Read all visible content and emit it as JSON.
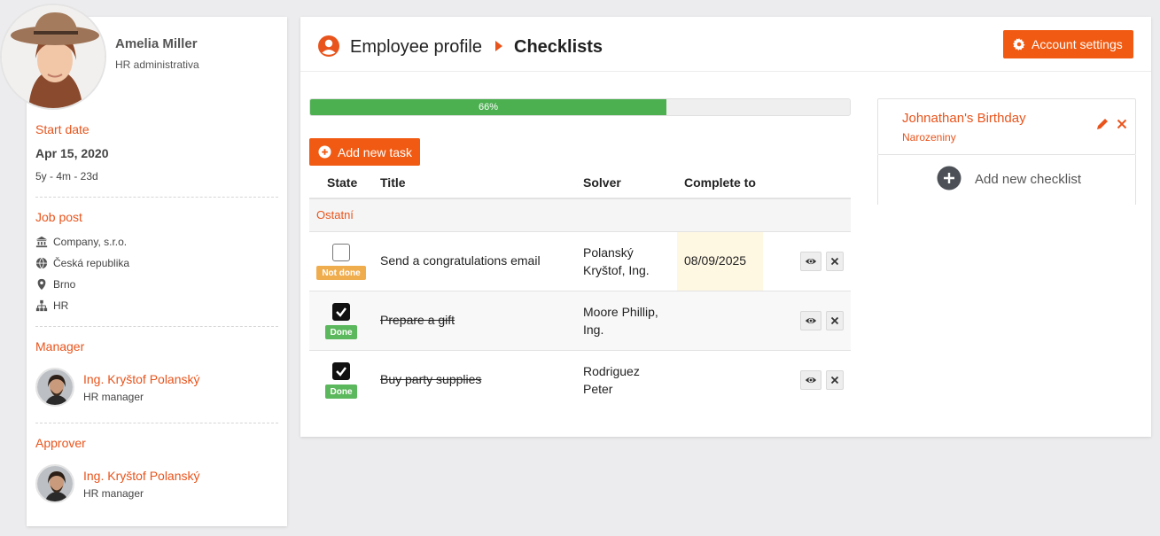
{
  "profile": {
    "name": "Amelia Miller",
    "role": "HR administrativa",
    "start_date_label": "Start date",
    "start_date": "Apr 15, 2020",
    "duration": "5y - 4m - 23d",
    "job_post_label": "Job post",
    "company": "Company, s.r.o.",
    "country": "Česká republika",
    "city": "Brno",
    "department": "HR",
    "manager_label": "Manager",
    "manager": {
      "name": "Ing. Kryštof Polanský",
      "role": "HR manager"
    },
    "approver_label": "Approver",
    "approver": {
      "name": "Ing. Kryštof Polanský",
      "role": "HR manager"
    }
  },
  "header": {
    "title": "Employee profile",
    "subtitle": "Checklists",
    "account_settings_label": "Account settings"
  },
  "progress": {
    "value": 0.66,
    "label": "66%"
  },
  "add_task_label": "Add new task",
  "table": {
    "columns": [
      "State",
      "Title",
      "Solver",
      "Complete to"
    ],
    "group": "Ostatní",
    "rows": [
      {
        "state": "Not done",
        "title": "Send a congratulations email",
        "solver_line1": "Polanský",
        "solver_line2": "Kryštof, Ing.",
        "complete_to": "08/09/2025"
      },
      {
        "state": "Done",
        "title": "Prepare a gift",
        "solver_line1": "Moore Phillip,",
        "solver_line2": "Ing.",
        "complete_to": ""
      },
      {
        "state": "Done",
        "title": "Buy party supplies",
        "solver_line1": "Rodriguez",
        "solver_line2": "Peter",
        "complete_to": ""
      }
    ]
  },
  "checklist": {
    "title": "Johnathan's Birthday",
    "subtitle": "Narozeniny",
    "add_label": "Add new checklist"
  },
  "colors": {
    "accent": "#e8541c",
    "button": "#f05a12",
    "success": "#4caf50",
    "warning": "#f0ad4e",
    "date_highlight": "#fef7e2"
  }
}
